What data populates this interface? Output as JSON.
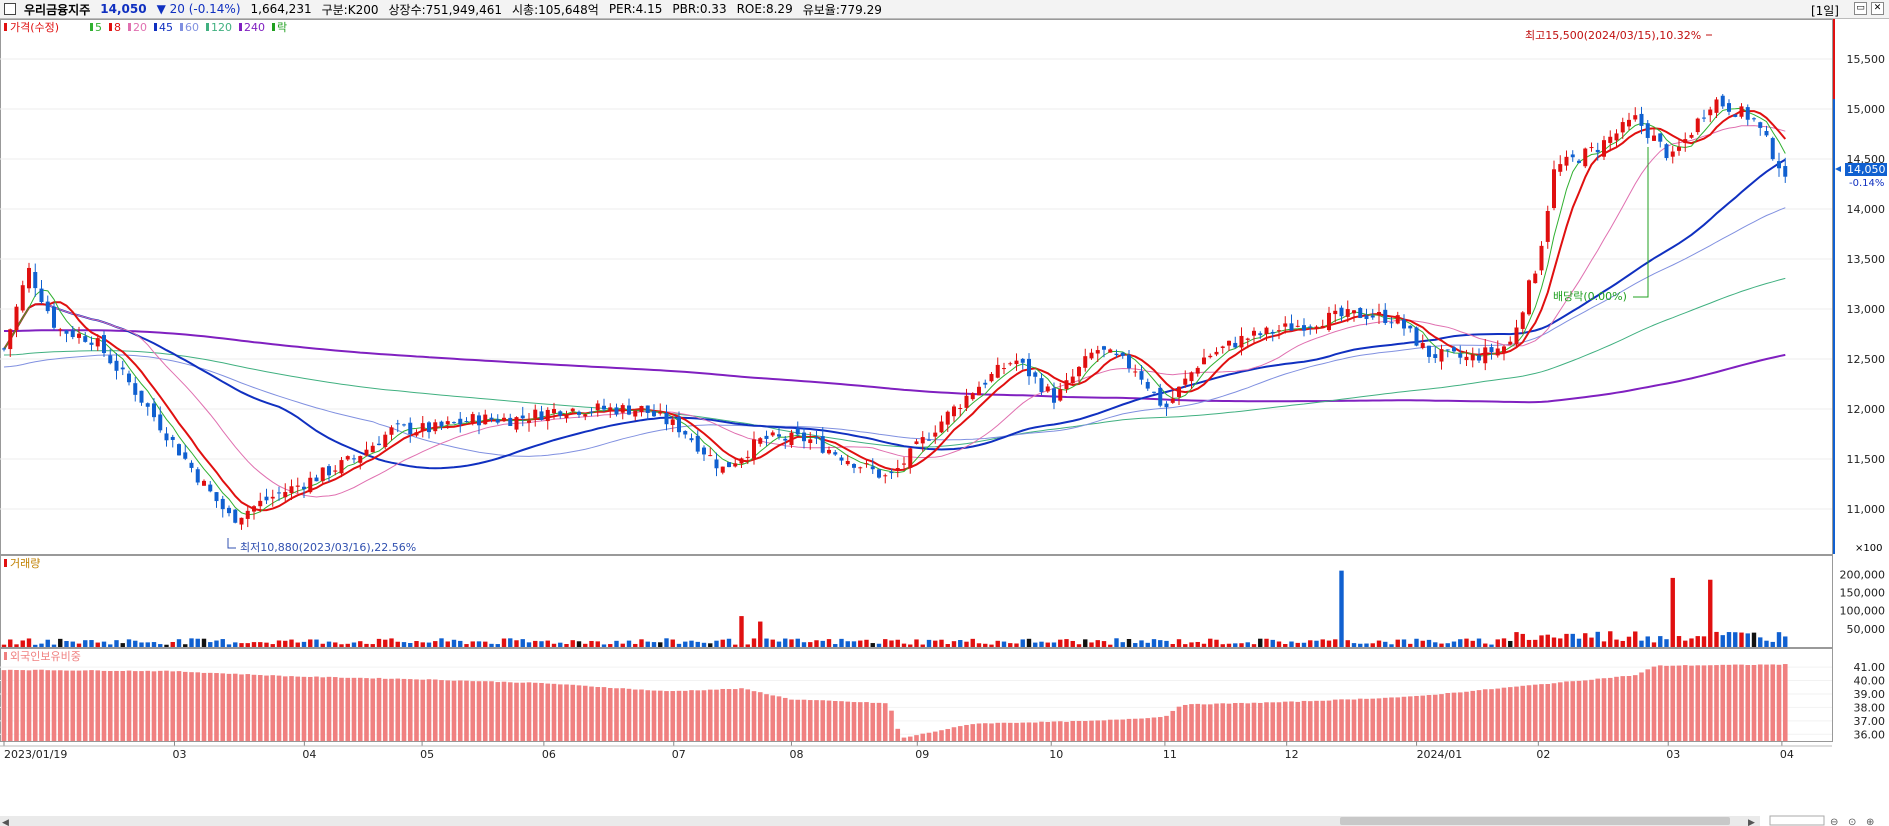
{
  "header": {
    "name": "우리금융지주",
    "price": "14,050",
    "change": "▼ 20 (-0.14%)",
    "volume": "1,664,231",
    "market": "구분:K200",
    "listed": "상장수:751,949,461",
    "marketcap": "시총:105,648억",
    "per": "PER:4.15",
    "pbr": "PBR:0.33",
    "roe": "ROE:8.29",
    "float": "유보율:779.29",
    "period": "[1일]"
  },
  "legend": {
    "price_label": "가격(수정)",
    "ma": [
      "5",
      "8",
      "20",
      "45",
      "60",
      "120",
      "240"
    ],
    "drop_label": "락",
    "volume_label": "거래량",
    "foreign_label": "외국인보유비중"
  },
  "annotations": {
    "high": "최고15,500(2024/03/15),10.32%",
    "low": "최저10,880(2023/03/16),22.56%",
    "dividend": "배당락(0.00%)",
    "current_price": "14,050",
    "current_change": "-0.14%",
    "vol_100": "×100"
  },
  "colors": {
    "up": "#e01010",
    "down": "#1060d0",
    "ma5": "#30b030",
    "ma8": "#e01010",
    "ma20": "#e070b0",
    "ma45": "#1030c0",
    "ma60": "#8090e0",
    "ma120": "#40b080",
    "ma240": "#8020c0",
    "foreign": "#f08080"
  },
  "chart_data": [
    {
      "type": "line",
      "title": "우리금융지주",
      "series_note": "candlestick",
      "x_labels": [
        "2023/01/19",
        "03",
        "04",
        "05",
        "06",
        "07",
        "08",
        "09",
        "10",
        "11",
        "12",
        "2024/01",
        "02",
        "03",
        "04"
      ],
      "ylim": [
        10700,
        15800
      ],
      "y_ticks": [
        "11,000",
        "11,500",
        "12,000",
        "12,500",
        "13,000",
        "13,500",
        "14,000",
        "14,500",
        "15,000",
        "15,500"
      ],
      "approx_path": [
        [
          "2023/01/19",
          12600
        ],
        [
          "2023/01/25",
          13400
        ],
        [
          "2023/02/01",
          12800
        ],
        [
          "2023/02/10",
          12700
        ],
        [
          "2023/02/20",
          12200
        ],
        [
          "2023/03/01",
          11700
        ],
        [
          "2023/03/10",
          11200
        ],
        [
          "2023/03/16",
          10900
        ],
        [
          "2023/03/25",
          11100
        ],
        [
          "2023/04/05",
          11300
        ],
        [
          "2023/04/15",
          11500
        ],
        [
          "2023/04/25",
          11800
        ],
        [
          "2023/05/05",
          11800
        ],
        [
          "2023/05/15",
          11900
        ],
        [
          "2023/05/25",
          11900
        ],
        [
          "2023/06/05",
          12000
        ],
        [
          "2023/06/15",
          12000
        ],
        [
          "2023/06/25",
          12000
        ],
        [
          "2023/07/05",
          11800
        ],
        [
          "2023/07/15",
          11400
        ],
        [
          "2023/07/25",
          11700
        ],
        [
          "2023/08/05",
          11700
        ],
        [
          "2023/08/15",
          11500
        ],
        [
          "2023/08/25",
          11300
        ],
        [
          "2023/09/05",
          11800
        ],
        [
          "2023/09/15",
          12200
        ],
        [
          "2023/09/25",
          12500
        ],
        [
          "2023/10/05",
          12100
        ],
        [
          "2023/10/15",
          12600
        ],
        [
          "2023/10/25",
          12400
        ],
        [
          "2023/11/01",
          12000
        ],
        [
          "2023/11/10",
          12500
        ],
        [
          "2023/11/20",
          12700
        ],
        [
          "2023/11/30",
          12800
        ],
        [
          "2023/12/10",
          12900
        ],
        [
          "2023/12/20",
          12950
        ],
        [
          "2023/12/28",
          12900
        ],
        [
          "2024/01/05",
          12550
        ],
        [
          "2024/01/15",
          12500
        ],
        [
          "2024/01/25",
          12650
        ],
        [
          "2024/02/01",
          13500
        ],
        [
          "2024/02/05",
          14400
        ],
        [
          "2024/02/15",
          14600
        ],
        [
          "2024/02/25",
          14900
        ],
        [
          "2024/03/05",
          14500
        ],
        [
          "2024/03/15",
          15100
        ],
        [
          "2024/03/25",
          14900
        ],
        [
          "2024/04/01",
          14400
        ],
        [
          "2024/04/03",
          14050
        ]
      ]
    },
    {
      "type": "bar",
      "title": "거래량",
      "unit": "×100",
      "y_ticks": [
        "50,000",
        "100,000",
        "150,000",
        "200,000"
      ],
      "spikes": [
        [
          "2023/07/20",
          85000
        ],
        [
          "2023/07/24",
          70000
        ],
        [
          "2023/12/15",
          210000
        ],
        [
          "2024/03/05",
          190000
        ],
        [
          "2024/03/15",
          185000
        ]
      ],
      "typical": 15000
    },
    {
      "type": "bar",
      "title": "외국인보유비중",
      "y_ticks": [
        "36.00",
        "37.00",
        "38.00",
        "39.00",
        "40.00",
        "41.00"
      ],
      "ylim": [
        35.5,
        41.6
      ],
      "approx_path": [
        [
          "2023/01/19",
          40.8
        ],
        [
          "2023/03/01",
          40.7
        ],
        [
          "2023/04/01",
          40.3
        ],
        [
          "2023/05/01",
          40.1
        ],
        [
          "2023/06/01",
          39.8
        ],
        [
          "2023/07/01",
          39.2
        ],
        [
          "2023/07/20",
          39.4
        ],
        [
          "2023/08/01",
          38.6
        ],
        [
          "2023/08/25",
          38.3
        ],
        [
          "2023/08/28",
          35.7
        ],
        [
          "2023/09/15",
          36.8
        ],
        [
          "2023/10/15",
          37.0
        ],
        [
          "2023/11/01",
          37.3
        ],
        [
          "2023/11/05",
          38.2
        ],
        [
          "2023/12/01",
          38.4
        ],
        [
          "2024/01/01",
          38.8
        ],
        [
          "2024/02/01",
          39.7
        ],
        [
          "2024/02/25",
          40.4
        ],
        [
          "2024/03/01",
          41.1
        ],
        [
          "2024/04/03",
          41.2
        ]
      ]
    }
  ]
}
